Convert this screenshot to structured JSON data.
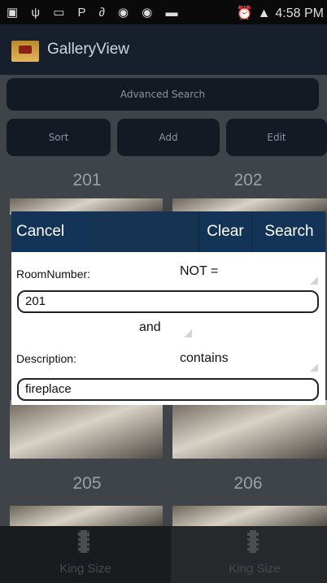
{
  "status": {
    "time": "4:58 PM"
  },
  "app": {
    "title": "GalleryView"
  },
  "toolbar": {
    "advanced_search": "Advanced Search",
    "sort": "Sort",
    "add": "Add",
    "edit": "Edit"
  },
  "gallery": {
    "rooms": [
      "201",
      "202",
      "205",
      "206"
    ]
  },
  "dialog": {
    "cancel": "Cancel",
    "clear": "Clear",
    "search": "Search",
    "criteria": [
      {
        "label": "RoomNumber:",
        "operator": "NOT =",
        "value": "201"
      },
      {
        "label": "Description:",
        "operator": "contains",
        "value": "fireplace"
      }
    ],
    "conjunction": "and"
  },
  "bottom_tabs": [
    "King Size",
    "King Size"
  ]
}
